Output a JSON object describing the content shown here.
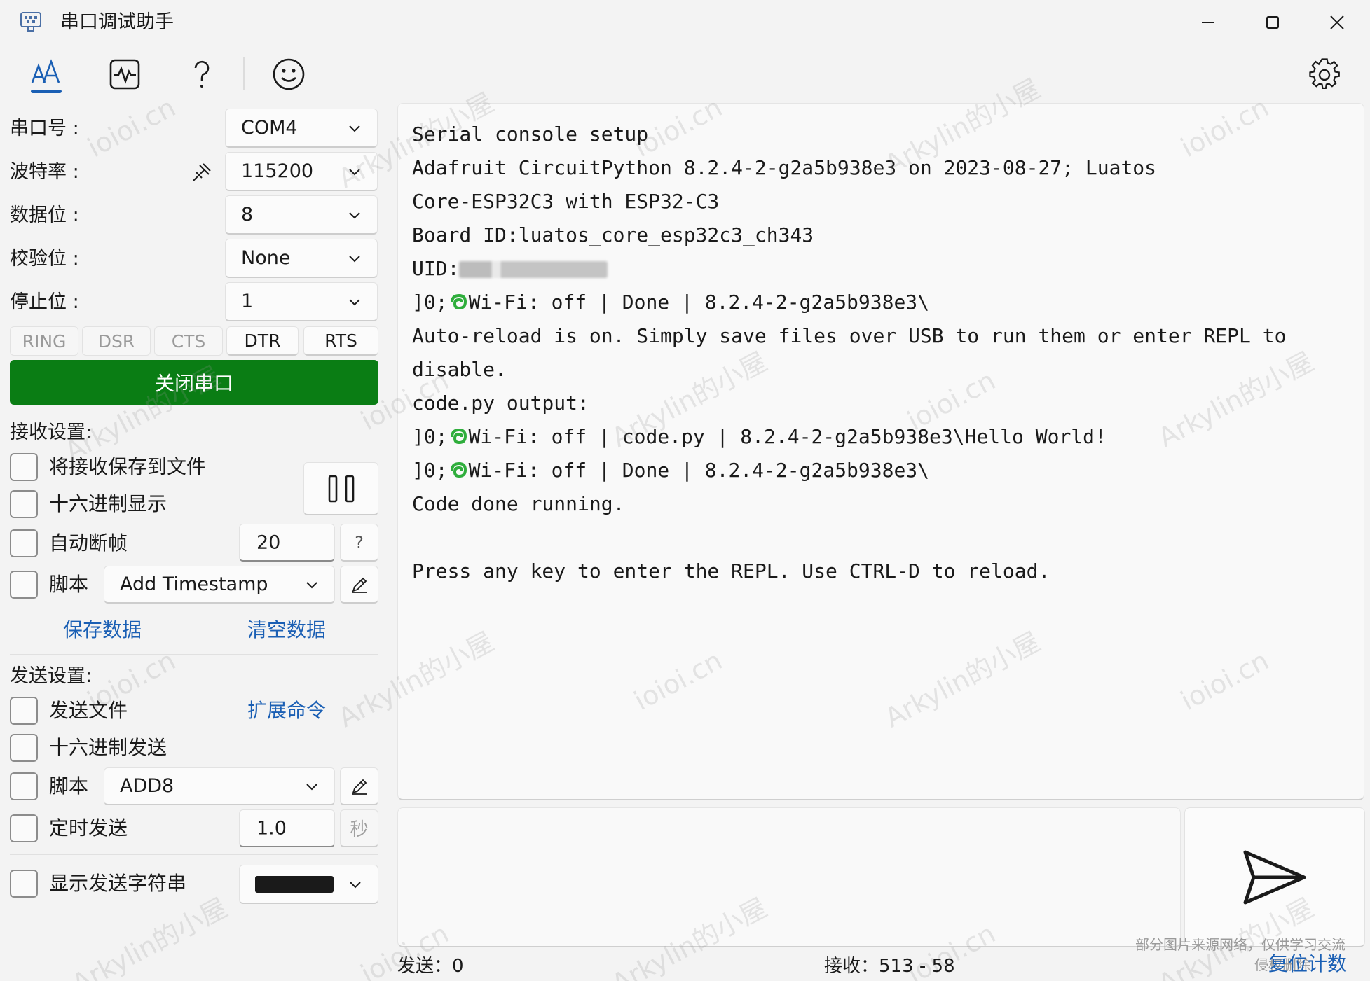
{
  "window": {
    "title": "串口调试助手",
    "controls": {
      "minimize": "minimize",
      "maximize": "maximize",
      "close": "close"
    }
  },
  "toolbar": {
    "items": [
      {
        "name": "font-settings",
        "icon": "text-size-icon",
        "active": true
      },
      {
        "name": "waveform",
        "icon": "waveform-icon",
        "active": false
      },
      {
        "name": "help",
        "icon": "question-icon",
        "active": false
      },
      {
        "name": "feedback",
        "icon": "smiley-icon",
        "active": false
      }
    ],
    "settings_icon": "gear-icon"
  },
  "serial": {
    "port_label": "串口号 :",
    "port_value": "COM4",
    "baud_label": "波特率 :",
    "baud_value": "115200",
    "databits_label": "数据位 :",
    "databits_value": "8",
    "parity_label": "校验位 :",
    "parity_value": "None",
    "stopbits_label": "停止位 :",
    "stopbits_value": "1",
    "pins": [
      {
        "label": "RING",
        "active": false
      },
      {
        "label": "DSR",
        "active": false
      },
      {
        "label": "CTS",
        "active": false
      },
      {
        "label": "DTR",
        "active": true
      },
      {
        "label": "RTS",
        "active": true
      }
    ],
    "toggle_button": "关闭串口",
    "toggle_color": "#0a7d14"
  },
  "receive": {
    "section_label": "接收设置:",
    "save_to_file": "将接收保存到文件",
    "hex_display": "十六进制显示",
    "auto_frame": "自动断帧",
    "auto_frame_value": "20",
    "auto_frame_help": "?",
    "script_label": "脚本",
    "script_value": "Add Timestamp",
    "save_data": "保存数据",
    "clear_data": "清空数据"
  },
  "send": {
    "section_label": "发送设置:",
    "send_file": "发送文件",
    "extend_cmd": "扩展命令",
    "hex_send": "十六进制发送",
    "script_label": "脚本",
    "script_value": "ADD8",
    "timed_send": "定时发送",
    "timed_value": "1.0",
    "timed_unit": "秒",
    "show_send_string": "显示发送字符串",
    "send_color": "#1a1a1a"
  },
  "console": {
    "line1": "Serial console setup",
    "line2": "Adafruit CircuitPython 8.2.4-2-g2a5b938e3 on 2023-08-27; Luatos",
    "line3": "Core-ESP32C3 with ESP32-C3",
    "line4": "Board ID:luatos_core_esp32c3_ch343",
    "line5": "UID:",
    "line6a": "]0;",
    "line6b": "Wi-Fi: off | Done | 8.2.4-2-g2a5b938e3\\",
    "line7": "Auto-reload is on. Simply save files over USB to run them or enter REPL to",
    "line8": "disable.",
    "line9": "code.py output:",
    "line10a": "]0;",
    "line10b": "Wi-Fi: off | code.py | 8.2.4-2-g2a5b938e3\\Hello World!",
    "line11a": "]0;",
    "line11b": "Wi-Fi: off | Done | 8.2.4-2-g2a5b938e3\\",
    "line12": "Code done running.",
    "line13": "Press any key to enter the REPL. Use CTRL-D to reload."
  },
  "status": {
    "sent_label": "发送：",
    "sent_value": "0",
    "recv_label": "接收：",
    "recv_value": "513 - 58",
    "reset": "复位计数"
  },
  "watermarks": {
    "text_a": "ioioi.cn",
    "text_b": "Arkylin的小屋",
    "note1": "部分图片来源网络，仅供学习交流",
    "note2": "侵权删除"
  }
}
